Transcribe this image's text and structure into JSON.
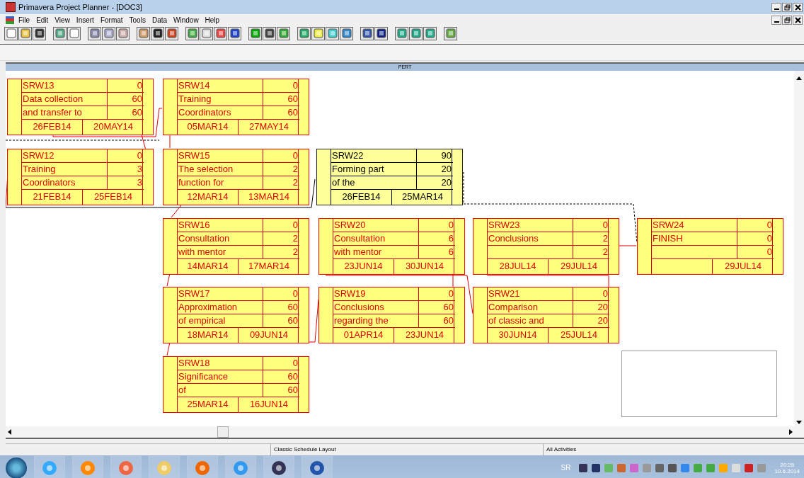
{
  "window": {
    "title": "Primavera Project Planner - [DOC3]"
  },
  "menu": [
    "File",
    "Edit",
    "View",
    "Insert",
    "Format",
    "Tools",
    "Data",
    "Window",
    "Help"
  ],
  "pane": {
    "title": "PERT"
  },
  "nodes": [
    {
      "code": "SRW13",
      "desc_1": "Data collection",
      "desc_2": "and transfer to",
      "num_1": "0",
      "num_2": "60",
      "num_3": "60",
      "start": "26FEB14",
      "finish": "20MAY14",
      "selected": false
    },
    {
      "code": "SRW14",
      "desc_1": "Training",
      "desc_2": "Coordinators",
      "num_1": "0",
      "num_2": "60",
      "num_3": "60",
      "start": "05MAR14",
      "finish": "27MAY14",
      "selected": false
    },
    {
      "code": "SRW12",
      "desc_1": "Training",
      "desc_2": "Coordinators",
      "num_1": "0",
      "num_2": "3",
      "num_3": "3",
      "start": "21FEB14",
      "finish": "25FEB14",
      "selected": false
    },
    {
      "code": "SRW15",
      "desc_1": "The selection",
      "desc_2": "function for",
      "num_1": "0",
      "num_2": "2",
      "num_3": "2",
      "start": "12MAR14",
      "finish": "13MAR14",
      "selected": false
    },
    {
      "code": "SRW22",
      "desc_1": "Forming part",
      "desc_2": "of the",
      "num_1": "90",
      "num_2": "20",
      "num_3": "20",
      "start": "26FEB14",
      "finish": "25MAR14",
      "selected": true
    },
    {
      "code": "SRW16",
      "desc_1": "Consultation",
      "desc_2": "with mentor",
      "num_1": "0",
      "num_2": "2",
      "num_3": "2",
      "start": "14MAR14",
      "finish": "17MAR14",
      "selected": false
    },
    {
      "code": "SRW20",
      "desc_1": "Consultation",
      "desc_2": "with mentor",
      "num_1": "0",
      "num_2": "6",
      "num_3": "6",
      "start": "23JUN14",
      "finish": "30JUN14",
      "selected": false
    },
    {
      "code": "SRW23",
      "desc_1": "Conclusions",
      "num_1": "0",
      "num_2": "2",
      "num_3": "2",
      "start": "28JUL14",
      "finish": "29JUL14",
      "selected": false
    },
    {
      "code": "SRW24",
      "desc_1": "FINISH",
      "num_1": "0",
      "num_2": "0",
      "num_3": "0",
      "finish": "29JUL14",
      "selected": false
    },
    {
      "code": "SRW17",
      "desc_1": "Approximation",
      "desc_2": "of empirical",
      "num_1": "0",
      "num_2": "60",
      "num_3": "60",
      "start": "18MAR14",
      "finish": "09JUN14",
      "selected": false
    },
    {
      "code": "SRW19",
      "desc_1": "Conclusions",
      "desc_2": "regarding the",
      "num_1": "0",
      "num_2": "60",
      "num_3": "60",
      "start": "01APR14",
      "finish": "23JUN14",
      "selected": false
    },
    {
      "code": "SRW21",
      "desc_1": "Comparison",
      "desc_2": "of classic and",
      "num_1": "0",
      "num_2": "20",
      "num_3": "20",
      "start": "30JUN14",
      "finish": "25JUL14",
      "selected": false
    },
    {
      "code": "SRW18",
      "desc_1": "Significance",
      "desc_2": "of",
      "num_1": "0",
      "num_2": "60",
      "num_3": "60",
      "start": "25MAR14",
      "finish": "16JUN14",
      "selected": false
    }
  ],
  "status_bar": {
    "layout": "Classic Schedule Layout",
    "filter": "All Activities"
  },
  "taskbar": {
    "language": "SR",
    "time": "20:28",
    "date": "10.6.2014"
  }
}
